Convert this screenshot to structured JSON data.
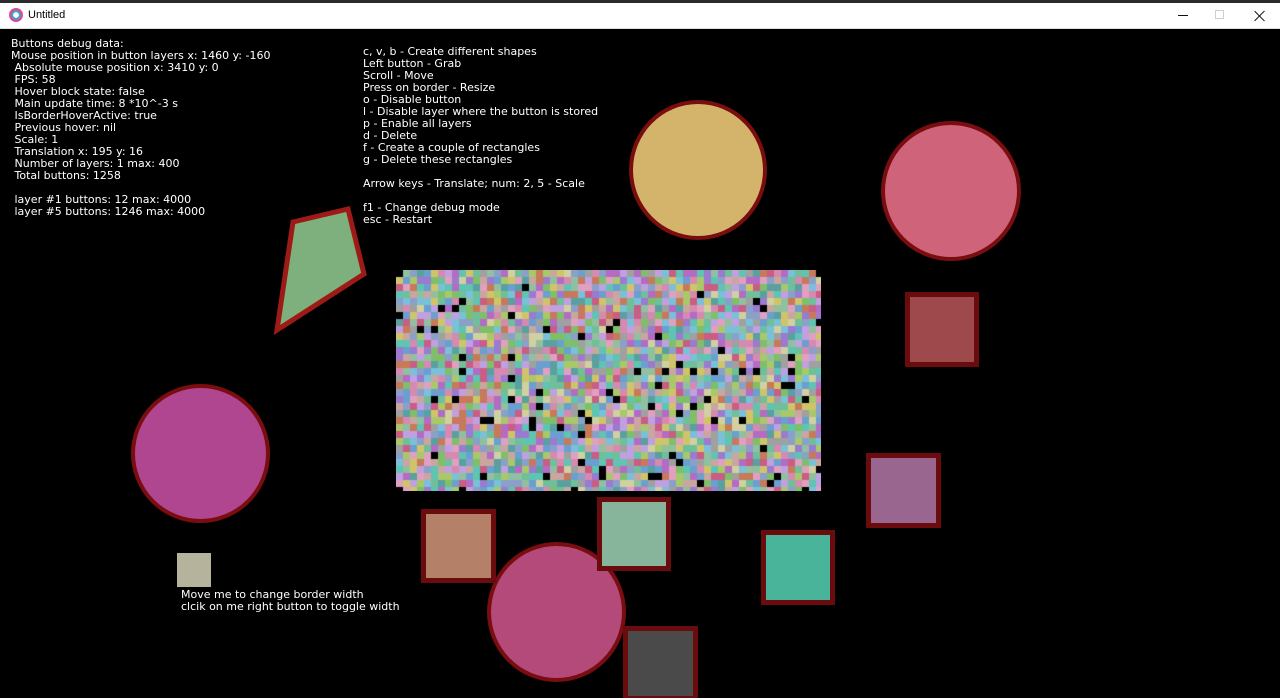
{
  "window": {
    "title": "Untitled"
  },
  "debug_panel": {
    "lines": [
      "Buttons debug data:",
      "Mouse position in button layers x: 1460 y: -160",
      " Absolute mouse position x: 3410 y: 0",
      " FPS: 58",
      " Hover block state: false",
      " Main update time: 8 *10^-3 s",
      " IsBorderHoverActive: true",
      " Previous hover: nil",
      " Scale: 1",
      " Translation x: 195 y: 16",
      " Number of layers: 1 max: 400",
      " Total buttons: 1258",
      "",
      " layer #1 buttons: 12 max: 4000",
      " layer #5 buttons: 1246 max: 4000"
    ]
  },
  "help_panel": {
    "lines": [
      "c, v, b - Create different shapes",
      "Left button - Grab",
      "Scroll - Move",
      "Press on border - Resize",
      "o - Disable button",
      "l - Disable layer where the button is stored",
      "p - Enable all layers",
      "d - Delete",
      "f - Create a couple of rectangles",
      "g - Delete these rectangles",
      "",
      "Arrow keys - Translate; num: 2, 5 - Scale",
      "",
      "f1 - Change debug mode",
      "esc - Restart"
    ]
  },
  "border_hint": {
    "line1": "Move me to change border width",
    "line2": "clcik on me right button to toggle width"
  },
  "shape_colors": {
    "circle_yellow": "#d4b46a",
    "circle_pink_top": "#cf6379",
    "circle_magenta": "#b04590",
    "circle_pink_bottom": "#b44a7a",
    "polygon": "#7eb07d",
    "square_red": "#9e4a4c",
    "square_purple": "#98668f",
    "square_teal": "#4ab49b",
    "square_sage": "#86b59b",
    "square_tan": "#b58068",
    "square_gray": "#4a4a4a",
    "border": "#7a0d10"
  }
}
